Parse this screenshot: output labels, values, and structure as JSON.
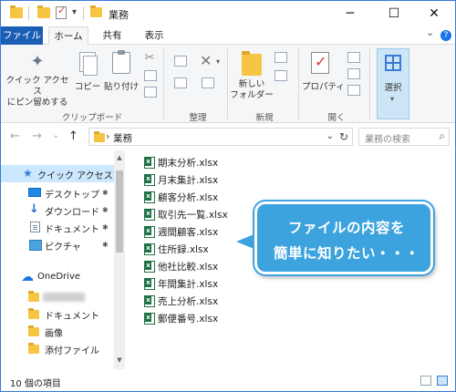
{
  "window": {
    "title": "業務",
    "controls": {
      "minimize": "─",
      "maximize": "☐",
      "close": "✕"
    }
  },
  "quick_access_toolbar": {
    "dropdown": "▾"
  },
  "ribbon": {
    "tabs": [
      {
        "label": "ファイル"
      },
      {
        "label": "ホーム"
      },
      {
        "label": "共有"
      },
      {
        "label": "表示"
      }
    ],
    "expand_icon": "⌄",
    "help_icon": "?",
    "buttons": {
      "pin_quick_access": "クイック アクセス\nにピン留めする",
      "copy": "コピー",
      "paste": "貼り付け",
      "new_folder": "新しい\nフォルダー",
      "properties": "プロパティ",
      "select": "選択"
    },
    "groups": {
      "clipboard": "クリップボード",
      "organize": "整理",
      "new": "新規",
      "open": "開く"
    }
  },
  "navigation": {
    "back": "←",
    "forward": "→",
    "history": "⌄",
    "up": "↑",
    "breadcrumb_separator": "›",
    "path": "業務",
    "address_dropdown": "⌄",
    "refresh": "↻",
    "search_placeholder": "業務の検索",
    "search_icon": "⌕"
  },
  "nav_pane": {
    "quick_access": "クイック アクセス",
    "pinned": [
      {
        "label": "デスクトップ",
        "icon": "desktop-icon"
      },
      {
        "label": "ダウンロード",
        "icon": "download-icon"
      },
      {
        "label": "ドキュメント",
        "icon": "documents-icon"
      },
      {
        "label": "ピクチャ",
        "icon": "pictures-icon"
      }
    ],
    "pin_glyph": "✱",
    "onedrive": "OneDrive",
    "onedrive_children": [
      {
        "label": "",
        "blurred": true
      },
      {
        "label": "ドキュメント"
      },
      {
        "label": "画像"
      },
      {
        "label": "添付ファイル"
      }
    ],
    "scroll_up": "▲",
    "scroll_down": "▼"
  },
  "files": [
    "期末分析.xlsx",
    "月末集計.xlsx",
    "顧客分析.xlsx",
    "取引先一覧.xlsx",
    "週間顧客.xlsx",
    "住所録.xlsx",
    "他社比較.xlsx",
    "年間集計.xlsx",
    "売上分析.xlsx",
    "郵便番号.xlsx"
  ],
  "callout": {
    "line1": "ファイルの内容を",
    "line2": "簡単に知りたい・・・"
  },
  "status": {
    "item_count": "10 個の項目"
  },
  "colors": {
    "accent": "#1a5fb4",
    "callout": "#3da3de",
    "selection": "#cce8ff",
    "excel_green": "#1e7145",
    "folder": "#f6c544"
  }
}
